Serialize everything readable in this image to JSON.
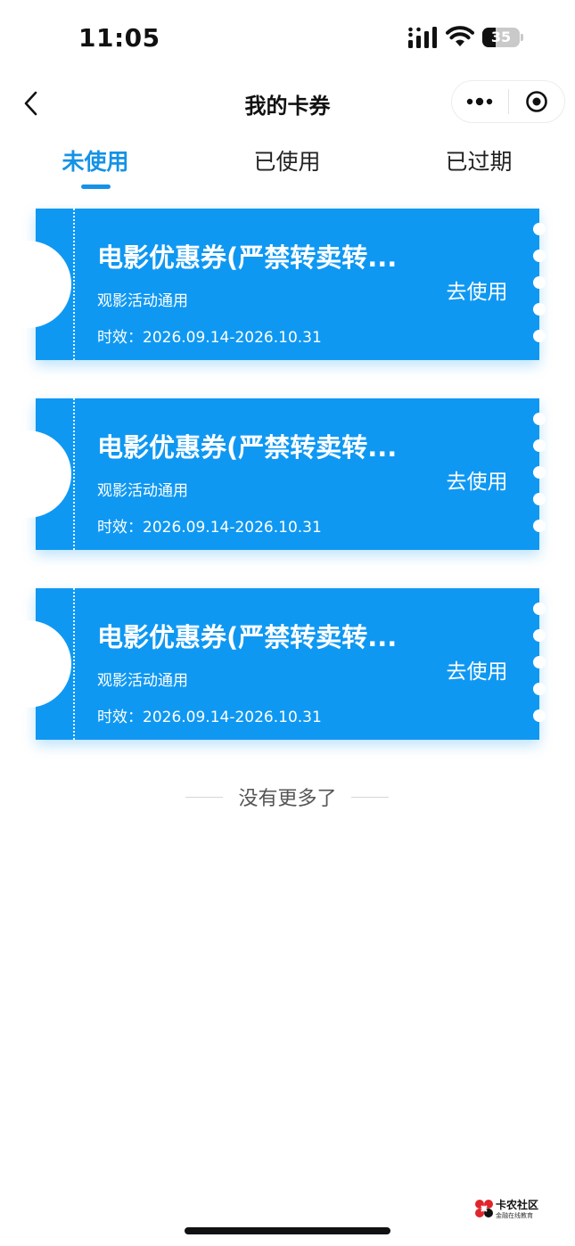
{
  "status_bar": {
    "time": "11:05",
    "battery_level": 35,
    "battery_text": "35"
  },
  "nav": {
    "title": "我的卡券",
    "back_icon": "chevron-left-icon",
    "more_icon": "more-dots-icon",
    "close_icon": "target-circle-icon"
  },
  "tabs": [
    {
      "label": "未使用",
      "active": true
    },
    {
      "label": "已使用",
      "active": false
    },
    {
      "label": "已过期",
      "active": false
    }
  ],
  "coupons": [
    {
      "title": "电影优惠券(严禁转卖转...",
      "description": "观影活动通用",
      "validity": "时效：2026.09.14-2026.10.31",
      "action_label": "去使用"
    },
    {
      "title": "电影优惠券(严禁转卖转...",
      "description": "观影活动通用",
      "validity": "时效：2026.09.14-2026.10.31",
      "action_label": "去使用"
    },
    {
      "title": "电影优惠券(严禁转卖转...",
      "description": "观影活动通用",
      "validity": "时效：2026.09.14-2026.10.31",
      "action_label": "去使用"
    }
  ],
  "footer": {
    "no_more_text": "没有更多了"
  },
  "watermark": {
    "main": "卡农社区",
    "sub": "金融在线教育"
  },
  "colors": {
    "accent": "#1592e6",
    "coupon_bg": "#0f98f2"
  }
}
